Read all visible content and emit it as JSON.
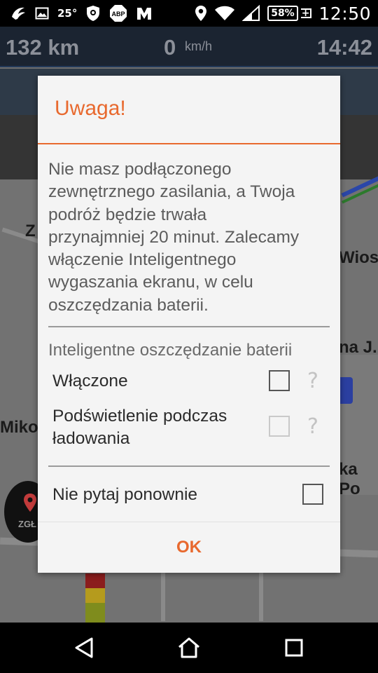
{
  "status_bar": {
    "temperature": "25°",
    "adblock_badge": "ABP",
    "battery_percent": "58%",
    "battery_charge_sign": "+",
    "time": "12:50"
  },
  "navigation_panel": {
    "distance": "132 km",
    "speed": "0",
    "speed_unit": "km/h",
    "arrival_time": "14:42"
  },
  "map_labels": [
    "Z",
    "Wiosc",
    "na J.",
    "Miko",
    "ka Po"
  ],
  "report_button_label": "ZGŁ",
  "dialog": {
    "title": "Uwaga!",
    "message_lines": [
      "Nie masz podłączonego",
      "zewnętrznego zasilania, a Twoja",
      "podróż będzie trwała",
      "przynajmniej 20 minut. Zalecamy",
      "włączenie Inteligentnego",
      "wygaszania ekranu, w celu",
      "oszczędzania baterii."
    ],
    "section_header": "Inteligentne oszczędzanie baterii",
    "options": [
      {
        "label_lines": [
          "Włączone"
        ],
        "checked": false,
        "enabled": true
      },
      {
        "label_lines": [
          "Podświetlenie podczas",
          "ładowania"
        ],
        "checked": false,
        "enabled": false
      }
    ],
    "dont_ask_label": "Nie pytaj ponownie",
    "dont_ask_checked": false,
    "ok_label": "OK",
    "accent_color": "#e8692e"
  },
  "icons": {
    "help": "?"
  }
}
